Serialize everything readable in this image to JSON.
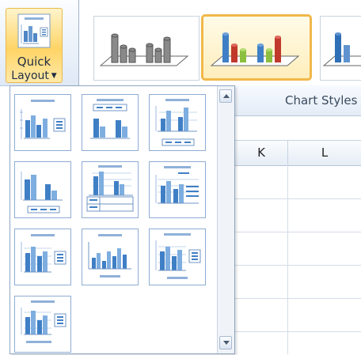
{
  "ribbon": {
    "quick_layout_line1": "Quick",
    "quick_layout_line2": "Layout",
    "chart_styles_label": "Chart Styles"
  },
  "sheet": {
    "columns": [
      "K",
      "L"
    ]
  },
  "quick_layout_menu": {
    "layout_count": 10
  },
  "colors": {
    "accent_highlight": "#f0b84a",
    "bar_blue": "#3f7fc5",
    "bar_red": "#c0392b",
    "bar_green": "#8cbf3f",
    "bar_gray": "#7a7a7a"
  }
}
